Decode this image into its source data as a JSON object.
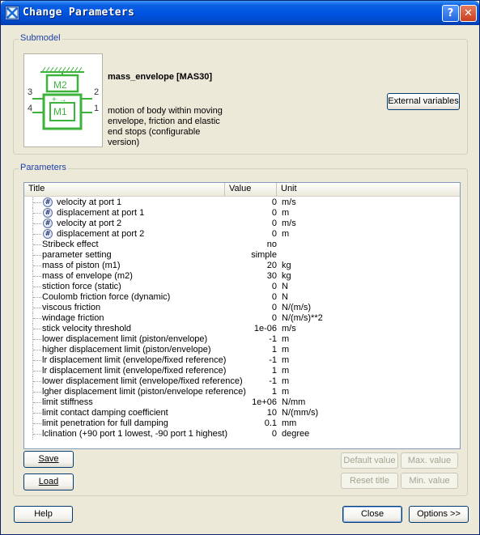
{
  "window": {
    "title": "Change Parameters"
  },
  "submodel": {
    "group_label": "Submodel",
    "name": "mass_envelope [MAS30]",
    "description": "motion of body within moving envelope, friction and elastic end stops (configurable version)",
    "external_variables_label": "External variables",
    "diagram": {
      "label_top": "M2",
      "label_bottom": "M1",
      "port1": "1",
      "port2": "2",
      "port3": "3",
      "port4": "4"
    }
  },
  "parameters": {
    "group_label": "Parameters",
    "columns": {
      "title": "Title",
      "value": "Value",
      "unit": "Unit"
    },
    "rows": [
      {
        "title": "velocity at port 1",
        "value": "0",
        "unit": "m/s",
        "icon": "#"
      },
      {
        "title": "displacement at port 1",
        "value": "0",
        "unit": "m",
        "icon": "#"
      },
      {
        "title": "velocity at port 2",
        "value": "0",
        "unit": "m/s",
        "icon": "#"
      },
      {
        "title": "displacement at port 2",
        "value": "0",
        "unit": "m",
        "icon": "#"
      },
      {
        "title": "Stribeck effect",
        "value": "no",
        "unit": ""
      },
      {
        "title": "parameter setting",
        "value": "simple",
        "unit": ""
      },
      {
        "title": "mass of piston (m1)",
        "value": "20",
        "unit": "kg"
      },
      {
        "title": "mass of envelope (m2)",
        "value": "30",
        "unit": "kg"
      },
      {
        "title": "stiction force (static)",
        "value": "0",
        "unit": "N"
      },
      {
        "title": "Coulomb friction force (dynamic)",
        "value": "0",
        "unit": "N"
      },
      {
        "title": "viscous friction",
        "value": "0",
        "unit": "N/(m/s)"
      },
      {
        "title": "windage friction",
        "value": "0",
        "unit": "N/(m/s)**2"
      },
      {
        "title": "stick velocity threshold",
        "value": "1e-06",
        "unit": "m/s"
      },
      {
        "title": "lower displacement limit (piston/envelope)",
        "value": "-1",
        "unit": "m"
      },
      {
        "title": "higher displacement limit (piston/envelope)",
        "value": "1",
        "unit": "m"
      },
      {
        "title": "lr displacement limit (envelope/fixed reference)",
        "value": "-1",
        "unit": "m"
      },
      {
        "title": "lr displacement limit (envelope/fixed reference)",
        "value": "1",
        "unit": "m"
      },
      {
        "title": "lower displacement limit (envelope/fixed reference)",
        "value": "-1",
        "unit": "m"
      },
      {
        "title": "lgher displacement limit (piston/envelope reference)",
        "value": "1",
        "unit": "m"
      },
      {
        "title": "limit stiffness",
        "value": "1e+06",
        "unit": "N/mm"
      },
      {
        "title": "limit contact damping coefficient",
        "value": "10",
        "unit": "N/(mm/s)"
      },
      {
        "title": "limit penetration for full damping",
        "value": "0.1",
        "unit": "mm"
      },
      {
        "title": "lclination (+90 port 1 lowest, -90 port 1 highest)",
        "value": "0",
        "unit": "degree"
      }
    ]
  },
  "buttons": {
    "save": "Save",
    "load": "Load",
    "default_value": "Default value",
    "max_value": "Max. value",
    "reset_title": "Reset title",
    "min_value": "Min. value",
    "help": "Help",
    "close": "Close",
    "options": "Options >>"
  },
  "colors": {
    "titlebar": "#0054e3",
    "group_label": "#1c3fa8",
    "diagram_green": "#3cb43c"
  }
}
